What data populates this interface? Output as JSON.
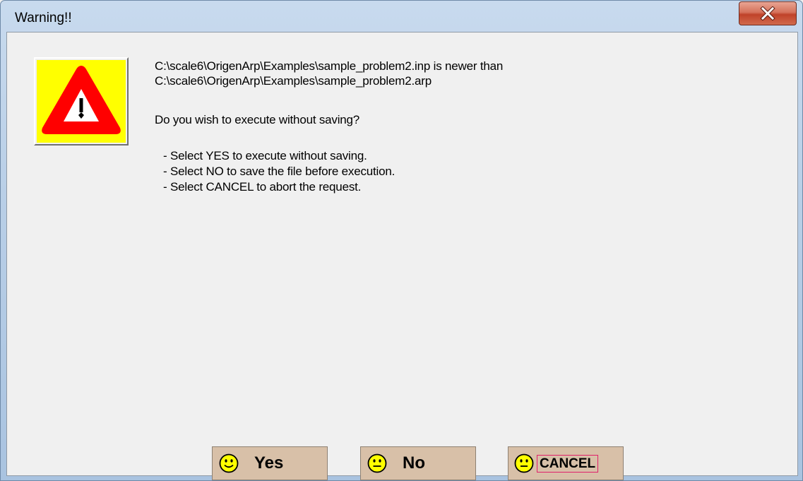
{
  "window": {
    "title": "Warning!!"
  },
  "icons": {
    "close": "close-icon",
    "warning": "warning-triangle-icon",
    "smiley": "smiley-icon",
    "neutral": "neutral-face-icon"
  },
  "colors": {
    "warning_bg": "#ffff00",
    "warning_triangle": "#ff0000",
    "button_bg": "#d8c0a8",
    "focus_border": "#e0206a"
  },
  "message": {
    "line1": "C:\\scale6\\OrigenArp\\Examples\\sample_problem2.inp is newer than",
    "line2": "C:\\scale6\\OrigenArp\\Examples\\sample_problem2.arp",
    "question": "Do you wish to execute without saving?",
    "options": [
      "- Select YES to execute without saving.",
      "- Select NO to save the file before execution.",
      "- Select CANCEL to abort the request."
    ]
  },
  "buttons": {
    "yes": "Yes",
    "no": "No",
    "cancel": "CANCEL"
  }
}
